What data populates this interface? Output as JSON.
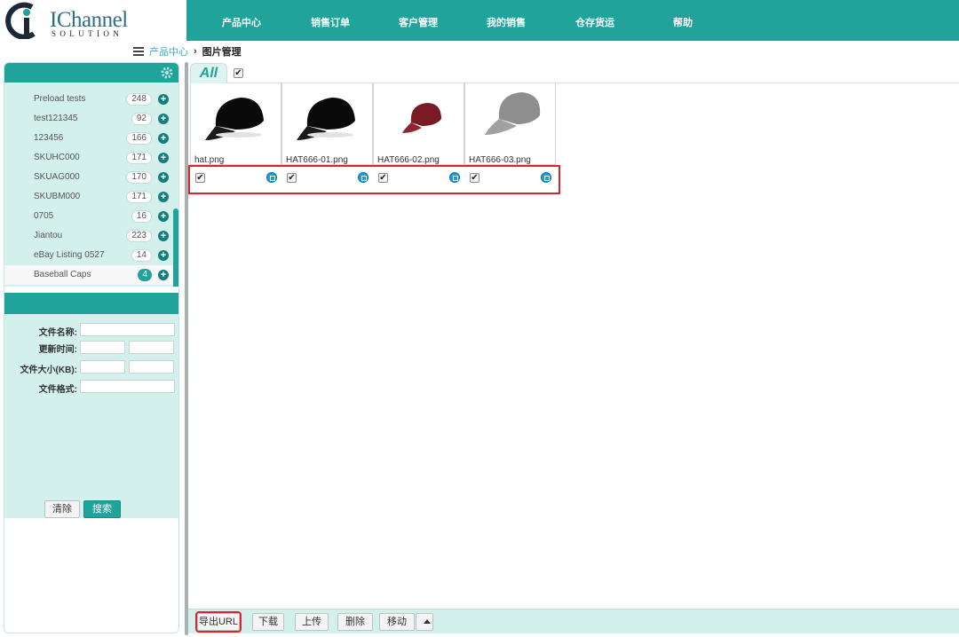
{
  "logo": {
    "text": "IChannel",
    "subtext": "SOLUTION"
  },
  "topnav": {
    "items": [
      {
        "label": "产品中心"
      },
      {
        "label": "销售订单"
      },
      {
        "label": "客户管理"
      },
      {
        "label": "我的销售"
      },
      {
        "label": "仓存货运"
      },
      {
        "label": "帮助"
      }
    ]
  },
  "breadcrumb": {
    "parent": "产品中心",
    "separator": "›",
    "current": "图片管理"
  },
  "sidebar": {
    "items": [
      {
        "label": "Preload tests",
        "count": "248"
      },
      {
        "label": "test121345",
        "count": "92"
      },
      {
        "label": "123456",
        "count": "166"
      },
      {
        "label": "SKUHC000",
        "count": "171"
      },
      {
        "label": "SKUAG000",
        "count": "170"
      },
      {
        "label": "SKUBM000",
        "count": "171"
      },
      {
        "label": "0705",
        "count": "16"
      },
      {
        "label": "Jiantou",
        "count": "223"
      },
      {
        "label": "eBay Listing 0527",
        "count": "14"
      },
      {
        "label": "Baseball Caps",
        "count": "4"
      }
    ],
    "active_index": 9
  },
  "filter": {
    "filename_label": "文件名称:",
    "update_time_label": "更新时间:",
    "filesize_label": "文件大小(KB):",
    "format_label": "文件格式:",
    "clear_label": "清除",
    "search_label": "搜索"
  },
  "tabs": {
    "all_label": "All",
    "all_checked": true
  },
  "images": [
    {
      "name": "hat.png",
      "color": "#0a0a0a",
      "checked": true
    },
    {
      "name": "HAT666-01.png",
      "color": "#0a0a0a",
      "checked": true
    },
    {
      "name": "HAT666-02.png",
      "color": "#7a1a24",
      "checked": true
    },
    {
      "name": "HAT666-03.png",
      "color": "#8e8e8e",
      "checked": true
    }
  ],
  "toolbar": {
    "export_url": "导出URL",
    "download": "下载",
    "upload": "上传",
    "delete": "删除",
    "move": "移动"
  },
  "colors": {
    "accent": "#1fa39b",
    "panel": "#d4f0ec",
    "highlight": "#d9262e"
  }
}
